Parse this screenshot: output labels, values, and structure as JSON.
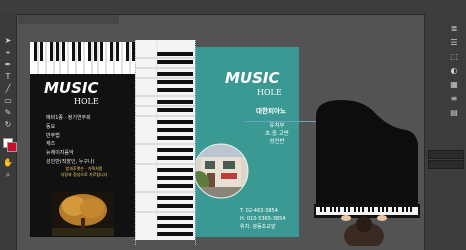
{
  "app": {
    "document_tab": ""
  },
  "menu": {
    "items": [
      "",
      "",
      "",
      "",
      "",
      "",
      "",
      "",
      "",
      ""
    ]
  },
  "left_card": {
    "title": "MUSIC",
    "subtitle": "HOLE",
    "list": [
      "예비1종 · 정기연주회",
      "동요",
      "반주법",
      "재즈",
      "뉴에이지음악",
      "성인반(직장인, 누구나)"
    ],
    "footer": [
      "방과후렛슨 · 가족처럼",
      "사랑과 정성으로 가르칩니다"
    ]
  },
  "right_card": {
    "title": "MUSIC",
    "subtitle": "HOLE",
    "academy": "대한피아노",
    "levels": [
      "유치부",
      "초.중.고반",
      "성인반"
    ],
    "contact": [
      "T. 02-463-3854",
      "H. 010-5365-3854",
      "위치: 광동초교앞"
    ]
  },
  "colors": {
    "teal": "#3a9a93",
    "dark": "#111111",
    "canvas": "#535353",
    "accent": "#ffd56b"
  }
}
